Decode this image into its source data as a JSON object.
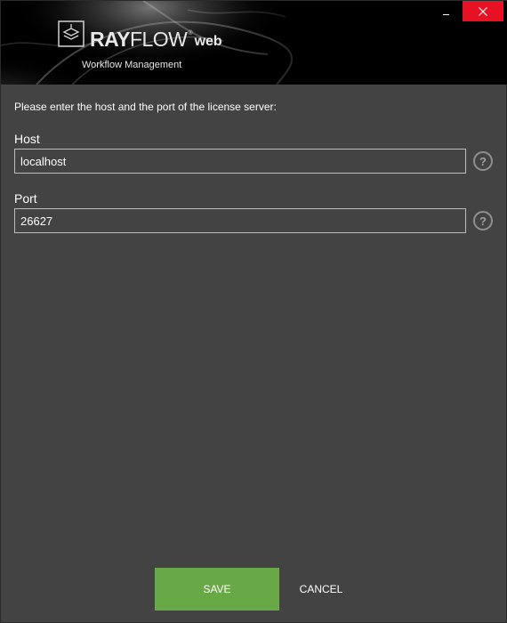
{
  "header": {
    "brand_ray": "RAY",
    "brand_flow": "FLOW",
    "brand_reg": "®",
    "brand_web": "web",
    "subtitle": "Workflow Management"
  },
  "window_controls": {
    "minimize_icon": "minimize-icon",
    "close_icon": "close-icon",
    "close_color": "#e81123"
  },
  "form": {
    "intro": "Please enter the host and the port of the license server:",
    "host": {
      "label": "Host",
      "value": "localhost"
    },
    "port": {
      "label": "Port",
      "value": "26627"
    },
    "help_icon": "question-mark-icon"
  },
  "footer": {
    "save_label": "SAVE",
    "cancel_label": "CANCEL",
    "accent": "#68a846"
  },
  "colors": {
    "background": "#434343",
    "header_background": "#000000"
  }
}
